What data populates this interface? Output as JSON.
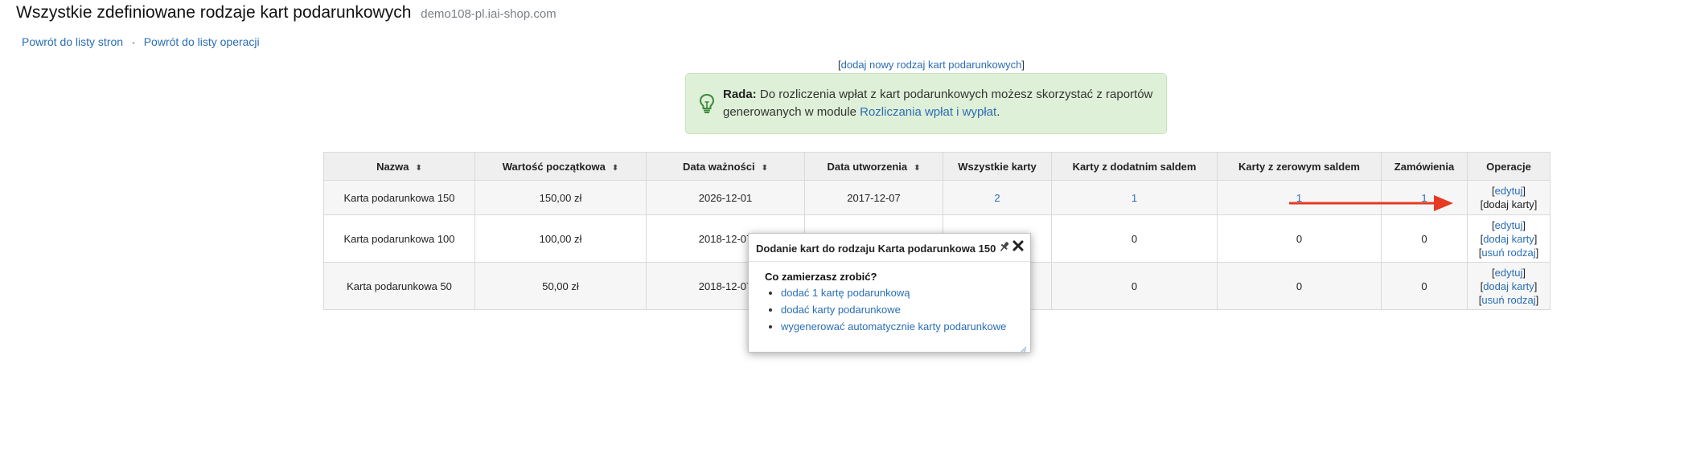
{
  "page": {
    "title": "Wszystkie zdefiniowane rodzaje kart podarunkowych",
    "domain": "demo108-pl.iai-shop.com"
  },
  "backlinks": {
    "pages": "Powrót do listy stron",
    "separator": "•",
    "operations": "Powrót do listy operacji"
  },
  "add_new": {
    "open": "[",
    "label": "dodaj nowy rodzaj kart podarunkowych",
    "close": "]"
  },
  "tip": {
    "heading": "Rada:",
    "text_before": " Do rozliczenia wpłat z kart podarunkowych możesz skorzystać z raportów generowanych w module ",
    "link": "Rozliczania wpłat i wypłat",
    "text_after": ".",
    "icon": "lightbulb-icon",
    "icon_color": "#3c8a3c"
  },
  "table": {
    "columns": [
      "Nazwa",
      "Wartość początkowa",
      "Data ważności",
      "Data utworzenia",
      "Wszystkie karty",
      "Karty z dodatnim saldem",
      "Karty z zerowym saldem",
      "Zamówienia",
      "Operacje"
    ],
    "sort_icon": "⬍",
    "rows": [
      {
        "name": "Karta podarunkowa 150",
        "value": "150,00 zł",
        "expiry": "2026-12-01",
        "created": "2017-12-07",
        "all_cards": "2",
        "positive": "1",
        "zero": "1",
        "orders": "1",
        "op_edit": "edytuj",
        "op_add": "dodaj karty"
      },
      {
        "name": "Karta podarunkowa 100",
        "value": "100,00 zł",
        "expiry": "2018-12-07",
        "positive": "0",
        "zero": "0",
        "orders": "0",
        "op_edit": "edytuj",
        "op_add": "dodaj karty",
        "op_delete": "usuń rodzaj"
      },
      {
        "name": "Karta podarunkowa 50",
        "value": "50,00 zł",
        "expiry": "2018-12-07",
        "positive": "0",
        "zero": "0",
        "orders": "0",
        "op_edit": "edytuj",
        "op_add": "dodaj karty",
        "op_delete": "usuń rodzaj"
      }
    ]
  },
  "annotation": {
    "arrow_color": "#e63a22"
  },
  "dialog": {
    "title": "Dodanie kart do rodzaju Karta podarunkowa 150",
    "question": "Co zamierzasz zrobić?",
    "options": [
      "dodać 1 kartę podarunkową",
      "dodać karty podarunkowe",
      "wygenerować automatycznie karty podarunkowe"
    ],
    "pin_icon": "pin-icon",
    "close_icon": "close-icon"
  }
}
